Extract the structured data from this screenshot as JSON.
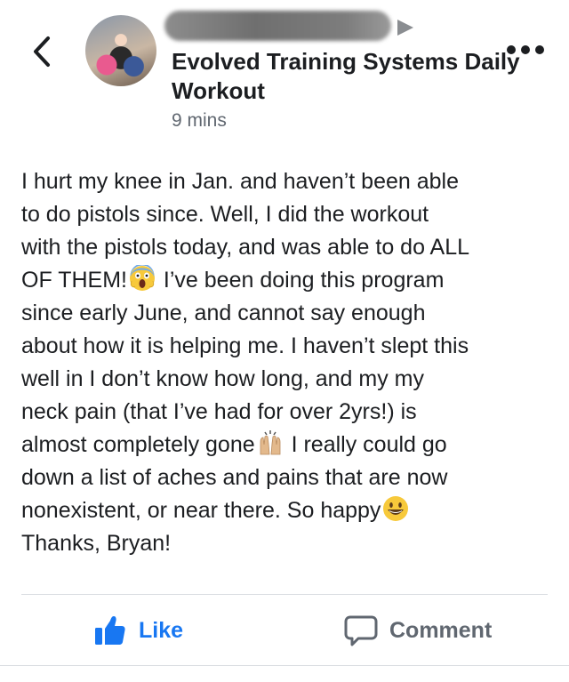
{
  "header": {
    "group_name": "Evolved Training Systems Daily Workout",
    "timestamp": "9 mins",
    "icons": {
      "back": "chevron-left-icon",
      "more": "more-options-icon",
      "arrow": "caret-right-icon",
      "avatar": "group-avatar"
    }
  },
  "post": {
    "lines": [
      {
        "text": "I hurt my knee in Jan. and haven’t been able"
      },
      {
        "text": "to do pistols since. Well, I did the workout"
      },
      {
        "text": "with the pistols today, and was able to do ALL"
      },
      {
        "text": "OF THEM!",
        "emoji": "screaming-face-emoji",
        "after": " I’ve been doing this program"
      },
      {
        "text": "since early June, and cannot say enough"
      },
      {
        "text": "about how it is helping me. I haven’t slept this"
      },
      {
        "text": "well in I don’t know how long, and my my"
      },
      {
        "text": "neck pain (that I’ve had for over 2yrs!) is"
      },
      {
        "text": "almost completely gone",
        "emoji": "raising-hands-emoji",
        "after": " I really could  go"
      },
      {
        "text": "down a list of aches and pains that are now"
      },
      {
        "text": "nonexistent, or near there. So happy",
        "emoji": "smiley-face-emoji",
        "after": ""
      },
      {
        "text": "Thanks, Bryan!"
      }
    ]
  },
  "actions": {
    "like_label": "Like",
    "comment_label": "Comment",
    "like_color": "#1877f2",
    "comment_color": "#606770",
    "icons": {
      "like": "thumbs-up-icon",
      "comment": "comment-bubble-icon"
    }
  }
}
